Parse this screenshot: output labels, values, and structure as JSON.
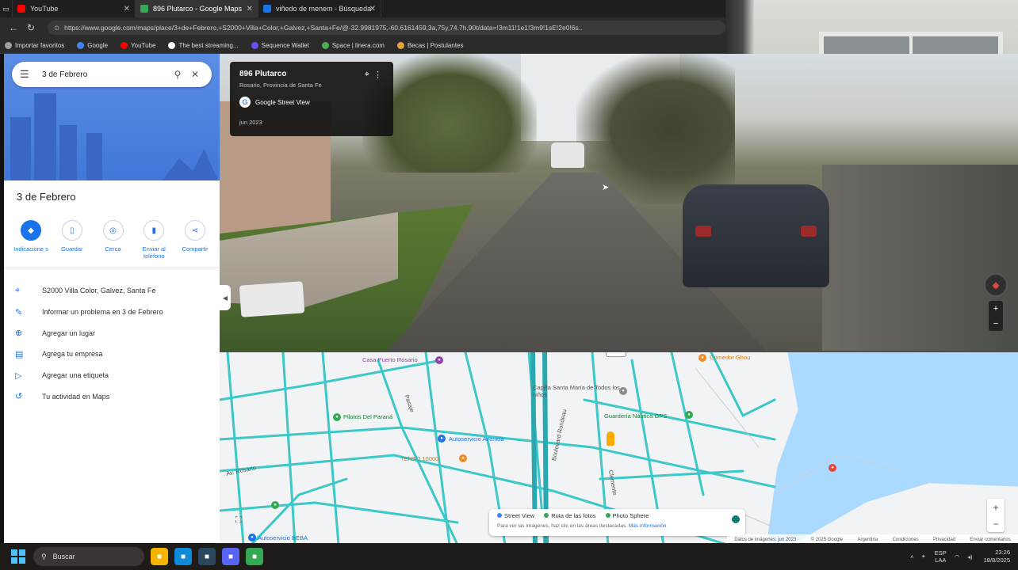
{
  "browser": {
    "tabs": [
      {
        "label": "YouTube",
        "color": "#ff0000"
      },
      {
        "label": "896 Plutarco - Google Maps",
        "color": "#34a853"
      },
      {
        "label": "viñedo de menem - Búsqueda",
        "color": "#1a73e8"
      }
    ],
    "url": "https://www.google.com/maps/place/3+de+Febrero,+S2000+Villa+Color,+Galvez,+Santa+Fe/@-32.9981975,-60.6161459,3a,75y,74.7h,90t/data=!3m11!1e1!3m9!1sE!2e0!6s..",
    "bookmarks": [
      {
        "label": "Importar favoritos",
        "color": "#9aa0a6"
      },
      {
        "label": "Google",
        "color": "#4285f4"
      },
      {
        "label": "YouTube",
        "color": "#ff0000"
      },
      {
        "label": "The best streaming...",
        "color": "#ffffff"
      },
      {
        "label": "Sequence Wallet",
        "color": "#6b4ef5"
      },
      {
        "label": "Space | linera.com",
        "color": "#4caf50"
      },
      {
        "label": "Becas | Postulantes",
        "color": "#e8a33d"
      }
    ]
  },
  "maps": {
    "search": {
      "value": "3 de Febrero"
    },
    "place_title": "3 de Febrero",
    "actions": [
      {
        "label": "Indicacione s",
        "icon": "directions-icon"
      },
      {
        "label": "Guardar",
        "icon": "bookmark-icon"
      },
      {
        "label": "Cerca",
        "icon": "nearby-icon"
      },
      {
        "label": "Enviar al teléfono",
        "icon": "send-to-phone-icon"
      },
      {
        "label": "Compartir",
        "icon": "share-icon"
      }
    ],
    "info": [
      {
        "label": "S2000 Villa Color, Galvez, Santa Fe",
        "icon": "location-pin-icon"
      },
      {
        "label": "Informar un problema en 3 de Febrero",
        "icon": "pencil-icon"
      },
      {
        "label": "Agregar un lugar",
        "icon": "add-place-icon"
      },
      {
        "label": "Agrega tu empresa",
        "icon": "store-icon"
      },
      {
        "label": "Agregar una etiqueta",
        "icon": "label-icon"
      },
      {
        "label": "Tu actividad en Maps",
        "icon": "history-icon"
      }
    ]
  },
  "streetview": {
    "title": "896 Plutarco",
    "subtitle": "Rosario, Provincia de Santa Fe",
    "brand": "Google Street View",
    "date": "jun 2023"
  },
  "map": {
    "labels": [
      {
        "text": "Casa Puerto Rosario",
        "class": "purple"
      },
      {
        "text": "Capilla Santa María de Todos los niños",
        "class": "grey"
      },
      {
        "text": "Guardería Náutica GPS",
        "class": "green"
      },
      {
        "text": "Pilotos Del Paraná",
        "class": "green"
      },
      {
        "text": "Autoservicio Avenida",
        "class": "blue"
      },
      {
        "text": "TENTO 10000",
        "class": "orange"
      },
      {
        "text": "Autoservicio BEBA",
        "class": "blue"
      },
      {
        "text": "Comedor Ghou",
        "class": "orange"
      },
      {
        "text": "Av. Rosario",
        "class": "grey"
      },
      {
        "text": "Boulevard Rondeau",
        "class": "grey"
      },
      {
        "text": "Pasaje",
        "class": "grey"
      },
      {
        "text": "Clemente",
        "class": "grey"
      }
    ],
    "layers": [
      {
        "label": "Street View",
        "color": "#4285f4"
      },
      {
        "label": "Ruta de las fotos",
        "color": "#34a853"
      },
      {
        "label": "Photo Sphere",
        "color": "#34a853"
      }
    ],
    "layer_hint": "Para ver las imágenes, haz clic en las áreas destacadas.",
    "layer_more": "Más información",
    "footer": [
      "Datos de imágenes: jun 2023",
      "© 2025 Google",
      "Argentina",
      "Condiciones",
      "Privacidad",
      "Enviar comentarios"
    ]
  },
  "taskbar": {
    "search_placeholder": "Buscar",
    "apps": [
      {
        "name": "file-explorer-icon",
        "color": "#f4b400"
      },
      {
        "name": "edge-icon",
        "color": "#0f8ad8"
      },
      {
        "name": "steam-icon",
        "color": "#2a475e"
      },
      {
        "name": "discord-icon",
        "color": "#5865f2"
      },
      {
        "name": "chrome-icon",
        "color": "#34a853"
      }
    ],
    "lang_top": "ESP",
    "lang_bottom": "LAA",
    "time": "23:26",
    "date": "18/8/2025"
  }
}
